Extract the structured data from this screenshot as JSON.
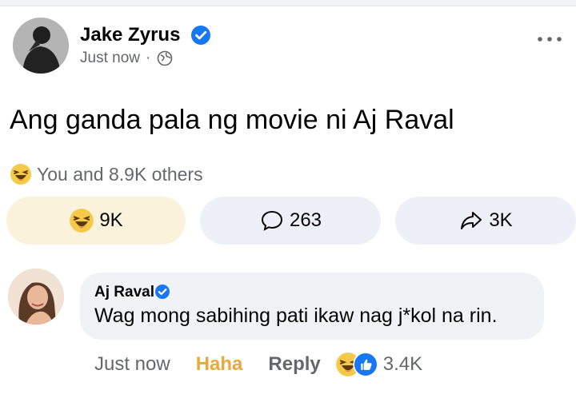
{
  "post": {
    "author": "Jake Zyrus",
    "timestamp": "Just now",
    "separator": "·",
    "privacy_icon": "globe-icon",
    "text": "Ang ganda pala ng movie ni Aj Raval",
    "reactions_summary": "You and 8.9K others"
  },
  "actions": {
    "react_count": "9K",
    "comment_count": "263",
    "share_count": "3K"
  },
  "comment": {
    "author": "Aj Raval",
    "text": "Wag mong sabihing pati ikaw nag j*kol na rin.",
    "timestamp": "Just now",
    "haha_label": "Haha",
    "reply_label": "Reply",
    "reaction_count": "3.4K"
  },
  "colors": {
    "verified": "#1877f2",
    "haha_active": "#e8a93a",
    "secondary_text": "#65676b",
    "button_bg": "#eef0f8",
    "active_button_bg": "#fbf2dc"
  }
}
